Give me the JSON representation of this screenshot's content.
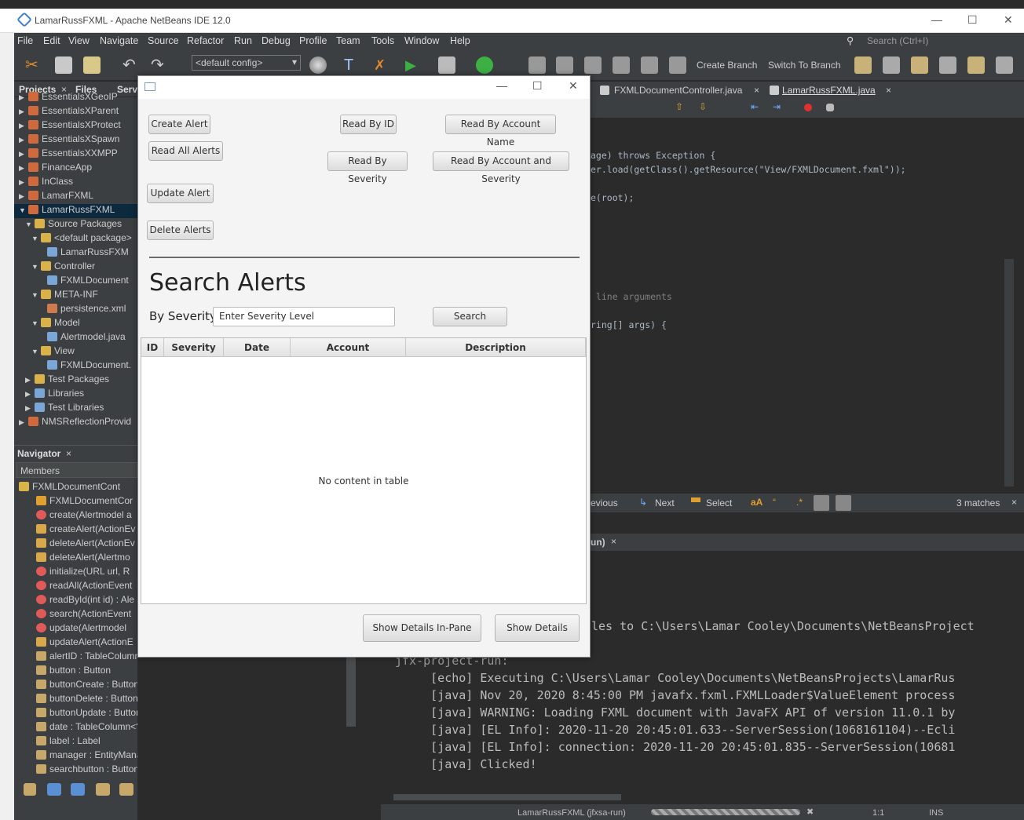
{
  "ide": {
    "window_title": "LamarRussFXML - Apache NetBeans IDE 12.0",
    "menu": [
      "File",
      "Edit",
      "View",
      "Navigate",
      "Source",
      "Refactor",
      "Run",
      "Debug",
      "Profile",
      "Team",
      "Tools",
      "Window",
      "Help"
    ],
    "search_placeholder": "Search (Ctrl+I)",
    "config": "<default config>",
    "create_branch": "Create Branch",
    "switch_branch": "Switch To Branch",
    "editor_tabs": [
      "FXMLDocumentController.java",
      "LamarRussFXML.java"
    ],
    "find_bar": {
      "previous": "evious",
      "next": "Next",
      "select": "Select",
      "matches": "3 matches"
    },
    "output_tab": "un)",
    "status_text": "LamarRussFXML (jfxsa-run)",
    "status_pos": "1:1",
    "status_ins": "INS"
  },
  "projects": {
    "tabs": [
      "Projects",
      "Files",
      "Serv"
    ],
    "rows": [
      {
        "label": "EssentialsXGeoIP",
        "indent": 0
      },
      {
        "label": "EssentialsXParent",
        "indent": 0
      },
      {
        "label": "EssentialsXProtect",
        "indent": 0
      },
      {
        "label": "EssentialsXSpawn",
        "indent": 0
      },
      {
        "label": "EssentialsXXMPP",
        "indent": 0
      },
      {
        "label": "FinanceApp",
        "indent": 0
      },
      {
        "label": "InClass",
        "indent": 0
      },
      {
        "label": "LamarFXML",
        "indent": 0
      },
      {
        "label": "LamarRussFXML",
        "indent": 0
      },
      {
        "label": "Source Packages",
        "indent": 1
      },
      {
        "label": "<default package>",
        "indent": 2
      },
      {
        "label": "LamarRussFXM",
        "indent": 3
      },
      {
        "label": "Controller",
        "indent": 2
      },
      {
        "label": "FXMLDocument",
        "indent": 3
      },
      {
        "label": "META-INF",
        "indent": 2
      },
      {
        "label": "persistence.xml",
        "indent": 3
      },
      {
        "label": "Model",
        "indent": 2
      },
      {
        "label": "Alertmodel.java",
        "indent": 3
      },
      {
        "label": "View",
        "indent": 2
      },
      {
        "label": "FXMLDocument.",
        "indent": 3
      },
      {
        "label": "Test Packages",
        "indent": 1
      },
      {
        "label": "Libraries",
        "indent": 1
      },
      {
        "label": "Test Libraries",
        "indent": 1
      },
      {
        "label": "NMSReflectionProvid",
        "indent": 0
      }
    ]
  },
  "navigator": {
    "title": "Navigator",
    "members_label": "Members",
    "rows": [
      "FXMLDocumentCont",
      "FXMLDocumentCor",
      "create(Alertmodel a",
      "createAlert(ActionEv",
      "deleteAlert(ActionEv",
      "deleteAlert(Alertmo",
      "initialize(URL url, R",
      "readAll(ActionEvent",
      "readById(int id) : Ale",
      "search(ActionEvent",
      "update(Alertmodel",
      "updateAlert(ActionE",
      "alertID : TableColumn<?, ?>",
      "button : Button",
      "buttonCreate : Button",
      "buttonDelete : Button",
      "buttonUpdate : Button",
      "date : TableColumn<?, ?>",
      "label : Label",
      "manager : EntityManager",
      "searchbutton : Button"
    ]
  },
  "code_lines": [
    "age) throws Exception {",
    "er.load(getClass().getResource(\"View/FXMLDocument.fxml\"));",
    "e(root);",
    " line arguments",
    "ring[] args) {"
  ],
  "output_lines": [
    "les to C:\\Users\\Lamar Cooley\\Documents\\NetBeansProject",
    "jfx-project-run:",
    "     [echo] Executing C:\\Users\\Lamar Cooley\\Documents\\NetBeansProjects\\LamarRus",
    "     [java] Nov 20, 2020 8:45:00 PM javafx.fxml.FXMLLoader$ValueElement process",
    "     [java] WARNING: Loading FXML document with JavaFX API of version 11.0.1 by",
    "     [java] [EL Info]: 2020-11-20 20:45:01.633--ServerSession(1068161104)--Ecli",
    "     [java] [EL Info]: connection: 2020-11-20 20:45:01.835--ServerSession(10681",
    "     [java] Clicked!"
  ],
  "app": {
    "buttons": {
      "create": "Create Alert",
      "read_all": "Read All Alerts",
      "update": "Update Alert",
      "delete": "Delete Alerts",
      "read_by_id": "Read By ID",
      "read_by_severity": "Read By Severity",
      "read_by_account_name": "Read By Account Name",
      "read_by_account_severity": "Read By Account and Severity",
      "search": "Search",
      "show_details_in_pane": "Show Details In-Pane",
      "show_details": "Show Details"
    },
    "heading": "Search Alerts",
    "by_severity_label": "By Severity",
    "severity_input": "Enter Severity Level",
    "table": {
      "columns": [
        "ID",
        "Severity",
        "Date",
        "Account",
        "Description"
      ],
      "empty_text": "No content in table"
    }
  }
}
